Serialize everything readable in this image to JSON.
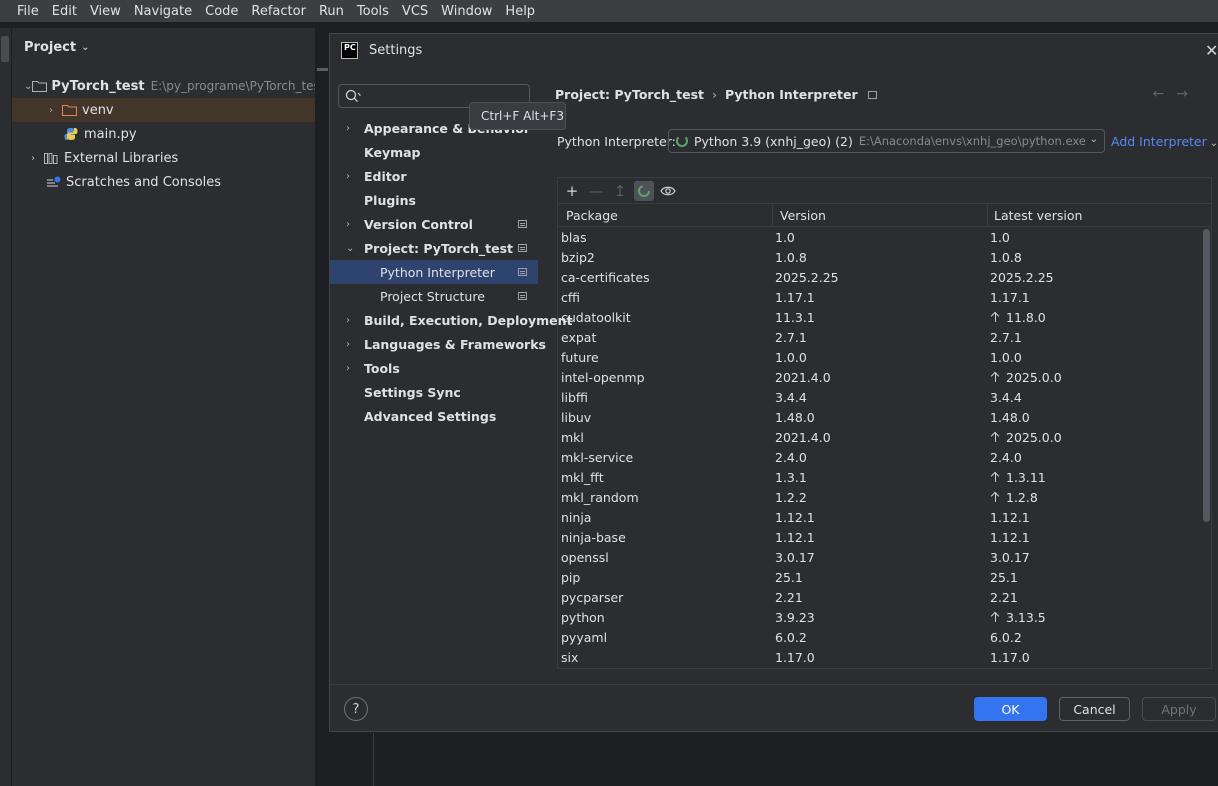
{
  "menubar": [
    "File",
    "Edit",
    "View",
    "Navigate",
    "Code",
    "Refactor",
    "Run",
    "Tools",
    "VCS",
    "Window",
    "Help"
  ],
  "project_panel": {
    "title": "Project",
    "root_name": "PyTorch_test",
    "root_path": "E:\\py_programe\\PyTorch_test",
    "venv": "venv",
    "main_file": "main.py",
    "external_libraries": "External Libraries",
    "scratches": "Scratches and Consoles"
  },
  "dialog": {
    "title": "Settings",
    "logo_text": "PC",
    "search_placeholder": "",
    "tooltip": "Ctrl+F Alt+F3",
    "nav": [
      {
        "label": "Appearance & Behavior",
        "expandable": true
      },
      {
        "label": "Keymap",
        "expandable": false
      },
      {
        "label": "Editor",
        "expandable": true
      },
      {
        "label": "Plugins",
        "expandable": false
      },
      {
        "label": "Version Control",
        "expandable": true
      },
      {
        "label": "Project: PyTorch_test",
        "expandable": true,
        "expanded": true
      },
      {
        "label": "Python Interpreter",
        "sub": true,
        "selected": true
      },
      {
        "label": "Project Structure",
        "sub": true
      },
      {
        "label": "Build, Execution, Deployment",
        "expandable": true
      },
      {
        "label": "Languages & Frameworks",
        "expandable": true
      },
      {
        "label": "Tools",
        "expandable": true
      },
      {
        "label": "Settings Sync",
        "expandable": false
      },
      {
        "label": "Advanced Settings",
        "expandable": false
      }
    ],
    "breadcrumb": {
      "parent": "Project: PyTorch_test",
      "current": "Python Interpreter"
    },
    "interpreter": {
      "label": "Python Interpreter:",
      "name": "Python 3.9 (xnhj_geo) (2)",
      "path": "E:\\Anaconda\\envs\\xnhj_geo\\python.exe",
      "add_label": "Add Interpreter"
    },
    "table": {
      "headers": [
        "Package",
        "Version",
        "Latest version"
      ],
      "rows": [
        {
          "package": "blas",
          "version": "1.0",
          "latest": "1.0",
          "upgrade": false
        },
        {
          "package": "bzip2",
          "version": "1.0.8",
          "latest": "1.0.8",
          "upgrade": false
        },
        {
          "package": "ca-certificates",
          "version": "2025.2.25",
          "latest": "2025.2.25",
          "upgrade": false
        },
        {
          "package": "cffi",
          "version": "1.17.1",
          "latest": "1.17.1",
          "upgrade": false
        },
        {
          "package": "cudatoolkit",
          "version": "11.3.1",
          "latest": "11.8.0",
          "upgrade": true
        },
        {
          "package": "expat",
          "version": "2.7.1",
          "latest": "2.7.1",
          "upgrade": false
        },
        {
          "package": "future",
          "version": "1.0.0",
          "latest": "1.0.0",
          "upgrade": false
        },
        {
          "package": "intel-openmp",
          "version": "2021.4.0",
          "latest": "2025.0.0",
          "upgrade": true
        },
        {
          "package": "libffi",
          "version": "3.4.4",
          "latest": "3.4.4",
          "upgrade": false
        },
        {
          "package": "libuv",
          "version": "1.48.0",
          "latest": "1.48.0",
          "upgrade": false
        },
        {
          "package": "mkl",
          "version": "2021.4.0",
          "latest": "2025.0.0",
          "upgrade": true
        },
        {
          "package": "mkl-service",
          "version": "2.4.0",
          "latest": "2.4.0",
          "upgrade": false
        },
        {
          "package": "mkl_fft",
          "version": "1.3.1",
          "latest": "1.3.11",
          "upgrade": true
        },
        {
          "package": "mkl_random",
          "version": "1.2.2",
          "latest": "1.2.8",
          "upgrade": true
        },
        {
          "package": "ninja",
          "version": "1.12.1",
          "latest": "1.12.1",
          "upgrade": false
        },
        {
          "package": "ninja-base",
          "version": "1.12.1",
          "latest": "1.12.1",
          "upgrade": false
        },
        {
          "package": "openssl",
          "version": "3.0.17",
          "latest": "3.0.17",
          "upgrade": false
        },
        {
          "package": "pip",
          "version": "25.1",
          "latest": "25.1",
          "upgrade": false
        },
        {
          "package": "pycparser",
          "version": "2.21",
          "latest": "2.21",
          "upgrade": false
        },
        {
          "package": "python",
          "version": "3.9.23",
          "latest": "3.13.5",
          "upgrade": true
        },
        {
          "package": "pyyaml",
          "version": "6.0.2",
          "latest": "6.0.2",
          "upgrade": false
        },
        {
          "package": "six",
          "version": "1.17.0",
          "latest": "1.17.0",
          "upgrade": false
        }
      ]
    },
    "buttons": {
      "help": "?",
      "ok": "OK",
      "cancel": "Cancel",
      "apply": "Apply"
    }
  },
  "colors": {
    "accent": "#3574f0",
    "selection": "#2e436e",
    "link": "#548af7"
  }
}
